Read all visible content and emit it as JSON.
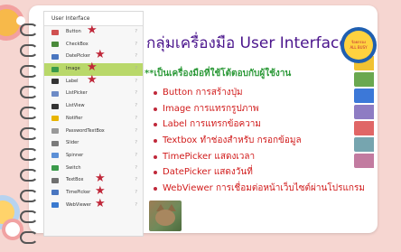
{
  "palette": {
    "header": "User Interface",
    "items": [
      {
        "label": "Button",
        "icon": "button-icon",
        "color": "#d05050",
        "starred": true,
        "selected": false
      },
      {
        "label": "CheckBox",
        "icon": "checkbox-icon",
        "color": "#4a8a3a",
        "starred": false,
        "selected": false
      },
      {
        "label": "DatePicker",
        "icon": "calendar-icon",
        "color": "#4a76c0",
        "starred": true,
        "selected": false
      },
      {
        "label": "Image",
        "icon": "image-icon",
        "color": "#3a9a4a",
        "starred": true,
        "selected": true
      },
      {
        "label": "Label",
        "icon": "label-icon",
        "color": "#333333",
        "starred": true,
        "selected": false
      },
      {
        "label": "ListPicker",
        "icon": "listpicker-icon",
        "color": "#6d8bc6",
        "starred": false,
        "selected": false
      },
      {
        "label": "ListView",
        "icon": "listview-icon",
        "color": "#333333",
        "starred": false,
        "selected": false
      },
      {
        "label": "Notifier",
        "icon": "warning-icon",
        "color": "#e8b400",
        "starred": false,
        "selected": false
      },
      {
        "label": "PasswordTextBox",
        "icon": "password-icon",
        "color": "#999999",
        "starred": false,
        "selected": false
      },
      {
        "label": "Slider",
        "icon": "slider-icon",
        "color": "#7a7a7a",
        "starred": false,
        "selected": false
      },
      {
        "label": "Spinner",
        "icon": "spinner-icon",
        "color": "#5b8fd6",
        "starred": false,
        "selected": false
      },
      {
        "label": "Switch",
        "icon": "switch-icon",
        "color": "#3a9a4a",
        "starred": false,
        "selected": false
      },
      {
        "label": "TextBox",
        "icon": "textbox-icon",
        "color": "#6f6f6f",
        "starred": true,
        "selected": false
      },
      {
        "label": "TimePicker",
        "icon": "clock-icon",
        "color": "#4a76c0",
        "starred": true,
        "selected": false
      },
      {
        "label": "WebViewer",
        "icon": "globe-icon",
        "color": "#3a7ad0",
        "starred": true,
        "selected": false
      }
    ],
    "help_glyph": "?"
  },
  "slide": {
    "title": "กลุ่มเครื่องมือ User Interface",
    "subtitle": "**เป็นเครื่องมือที่ใช้โต้ตอบกับผู้ใช้งาน",
    "bullets": [
      "Button การสร้างปุ่ม",
      "Image การแทรกรูปภาพ",
      "Label การแทรกข้อความ",
      "Textbox ทำช่องสำหรับ กรอกข้อมูล",
      "TimePicker แสดงเวลา",
      "DatePicker แสดงวันที่",
      "WebViewer การเชื่อมต่อหน้าเว็บไซต์ผ่านโปรแกรม"
    ],
    "logo": {
      "top": "ร้อยกรอง",
      "bottom": "ALL BUSY"
    },
    "accent_colors": {
      "title": "#4a148c",
      "subtitle": "#2e9a3a",
      "bullets": "#d11b1b",
      "stars": "#c0283a"
    },
    "tab_colors": [
      "#f39c33",
      "#f1c232",
      "#6aa84f",
      "#3c78d8",
      "#8e7cc3",
      "#e06666",
      "#76a5af",
      "#c27ba0"
    ]
  }
}
